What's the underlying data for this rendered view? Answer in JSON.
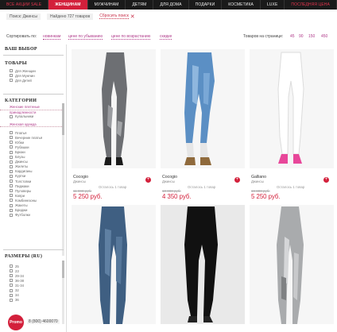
{
  "topnav": [
    {
      "label": "ВСЕ АКЦИИ SALE",
      "state": "sale"
    },
    {
      "label": "ЖЕНЩИНАМ",
      "state": "active"
    },
    {
      "label": "МУЖЧИНАМ",
      "state": ""
    },
    {
      "label": "ДЕТЯМ",
      "state": ""
    },
    {
      "label": "ДЛЯ ДОМА",
      "state": ""
    },
    {
      "label": "ПОДАРКИ",
      "state": ""
    },
    {
      "label": "КОСМЕТИКА",
      "state": ""
    },
    {
      "label": "LUXE",
      "state": ""
    },
    {
      "label": "ПОСЛЕДНЯЯ ЦЕНА",
      "state": "last"
    }
  ],
  "breadcrumbs": {
    "search": "Поиск: Джинсы",
    "found": "Найдено 727 товаров",
    "reset": "Сбросить поиск",
    "reset_icon": "close-icon"
  },
  "sort": {
    "label": "Сортировать по:",
    "options": [
      "новинкам",
      "цене по убыванию",
      "цене по возрастанию",
      "скидке"
    ],
    "per_page_label": "Товаров на странице:",
    "per_page": [
      "45",
      "90",
      "150",
      "450"
    ]
  },
  "sidebar": {
    "title": "ВАШ ВЫБОР",
    "goods": {
      "title": "ТОВАРЫ",
      "items": [
        "Для Женщин",
        "Для Мужчин",
        "Для Детей"
      ]
    },
    "categories": {
      "title": "КАТЕГОРИИ",
      "links": [
        "Женские плетеные принадлежности",
        "",
        "Женская одежда"
      ],
      "top_item": "Купальники",
      "items": [
        "Платья",
        "Вечерние платья",
        "Юбки",
        "Рубашки",
        "Брюки",
        "Блузы",
        "Джинсы",
        "Жилеты",
        "Кардиганы",
        "Куртки",
        "Толстовки",
        "Пиджаки",
        "Пуловеры",
        "Капри",
        "Комбинезоны",
        "Жакеты",
        "Бриджи",
        "Футболки"
      ]
    },
    "sizes": {
      "title": "РАЗМЕРЫ (RU)",
      "items": [
        "25",
        "23",
        "29-34",
        "36-38",
        "31-34",
        "32",
        "34",
        "36"
      ]
    }
  },
  "products": [
    {
      "brand": "Cocogio",
      "type": "Джинсы",
      "left": "Осталось 1 товар",
      "old": "11 000 руб.",
      "price": "5 250 руб."
    },
    {
      "brand": "Cocogio",
      "type": "Джинсы",
      "left": "Осталось 1 товар",
      "old": "10 000 руб.",
      "price": "4 350 руб."
    },
    {
      "brand": "Galliano",
      "type": "Джинсы",
      "left": "Осталось 1 товар",
      "old": "19 800 руб.",
      "price": "5 250 руб."
    }
  ],
  "promo": {
    "badge": "Promo",
    "phone": "8 (800) 4600070"
  },
  "colors": {
    "accent": "#d3203b",
    "link": "#b03a8a",
    "nav_bg": "#1a1a1a"
  }
}
